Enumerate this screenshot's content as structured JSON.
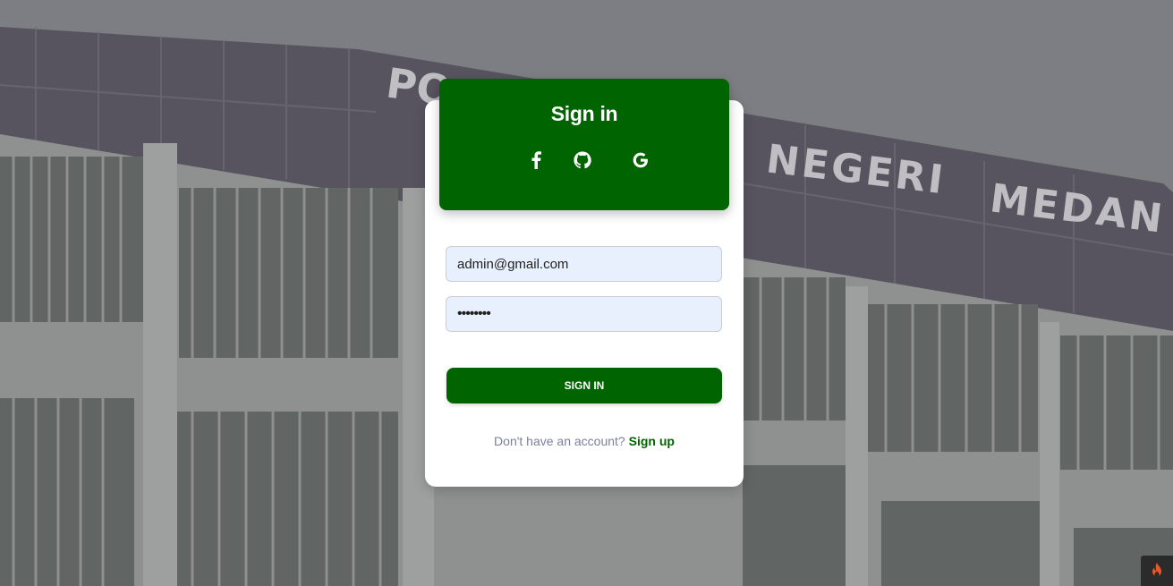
{
  "background": {
    "building_sign_words": [
      "PO",
      "NEGERI",
      "MEDAN"
    ]
  },
  "auth": {
    "title": "Sign in",
    "social": [
      {
        "name": "facebook",
        "icon": "facebook-icon"
      },
      {
        "name": "github",
        "icon": "github-icon"
      },
      {
        "name": "google",
        "icon": "google-icon"
      }
    ],
    "email_value": "admin@gmail.com",
    "password_value": "••••••••",
    "submit_label": "SIGN IN",
    "footer_text": "Don't have an account?",
    "footer_link": "Sign up"
  },
  "colors": {
    "primary": "#006400",
    "card": "#ffffff",
    "input_bg": "#e8f0fe",
    "muted_text": "#7b809a"
  },
  "debug": {
    "icon": "flame-icon"
  }
}
